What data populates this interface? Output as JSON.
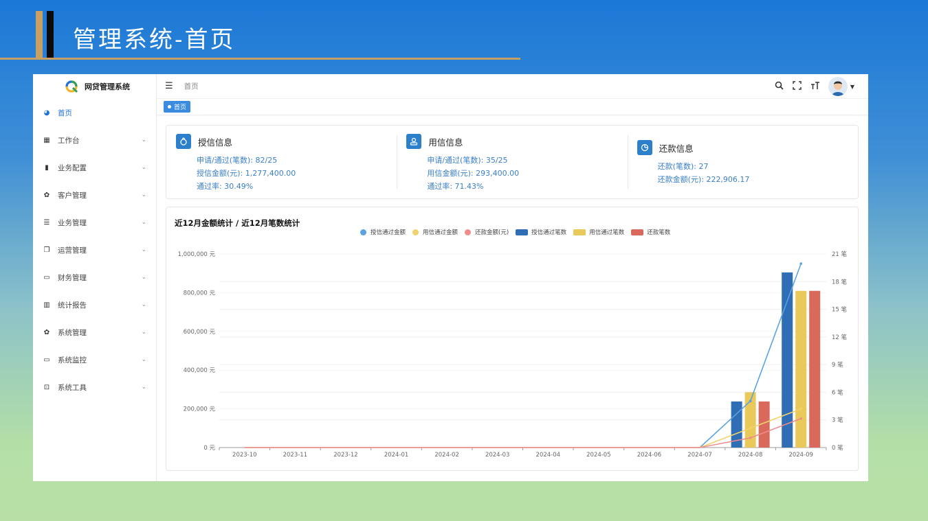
{
  "slide": {
    "title": "管理系统-首页"
  },
  "app": {
    "logo_text": "网贷管理系统",
    "breadcrumb": "首页",
    "tag": "首页"
  },
  "sidebar": {
    "items": [
      {
        "label": "首页",
        "icon": "dashboard-icon",
        "active": true,
        "expandable": false
      },
      {
        "label": "工作台",
        "icon": "grid-icon",
        "active": false,
        "expandable": true
      },
      {
        "label": "业务配置",
        "icon": "book-icon",
        "active": false,
        "expandable": true
      },
      {
        "label": "客户管理",
        "icon": "gear-icon",
        "active": false,
        "expandable": true
      },
      {
        "label": "业务管理",
        "icon": "sliders-icon",
        "active": false,
        "expandable": true
      },
      {
        "label": "运营管理",
        "icon": "copy-icon",
        "active": false,
        "expandable": true
      },
      {
        "label": "财务管理",
        "icon": "monitor-icon",
        "active": false,
        "expandable": true
      },
      {
        "label": "统计报告",
        "icon": "bar-chart-icon",
        "active": false,
        "expandable": true
      },
      {
        "label": "系统管理",
        "icon": "settings-icon",
        "active": false,
        "expandable": true
      },
      {
        "label": "系统监控",
        "icon": "monitor-icon",
        "active": false,
        "expandable": true
      },
      {
        "label": "系统工具",
        "icon": "toolbox-icon",
        "active": false,
        "expandable": true
      }
    ]
  },
  "info": [
    {
      "title": "授信信息",
      "icon": "money-bag-icon",
      "lines": [
        "申请/通过(笔数): 82/25",
        "授信金额(元): 1,277,400.00",
        "通过率: 30.49%"
      ]
    },
    {
      "title": "用信信息",
      "icon": "user-icon",
      "lines": [
        "申请/通过(笔数): 35/25",
        "用信金额(元): 293,400.00",
        "通过率: 71.43%"
      ]
    },
    {
      "title": "还款信息",
      "icon": "pie-icon",
      "lines": [
        "还款(笔数): 27",
        "还款金额(元): 222,906.17"
      ]
    }
  ],
  "colors": {
    "blue": "#2f6db5",
    "yellow": "#e8c95a",
    "red": "#d9695b",
    "line_blue": "#5ba3e0",
    "line_yellow": "#f2d36b",
    "line_red": "#f08c8c"
  },
  "chart_data": {
    "type": "bar+line",
    "title": "近12月金额统计 / 近12月笔数统计",
    "categories": [
      "2023-10",
      "2023-11",
      "2023-12",
      "2024-01",
      "2024-02",
      "2024-03",
      "2024-04",
      "2024-05",
      "2024-06",
      "2024-07",
      "2024-08",
      "2024-09"
    ],
    "y_left": {
      "ticks": [
        "0 元",
        "200,000 元",
        "400,000 元",
        "600,000 元",
        "800,000 元",
        "1,000,000 元"
      ],
      "range": [
        0,
        1000000
      ]
    },
    "y_right": {
      "ticks": [
        "0 笔",
        "3 笔",
        "6 笔",
        "9 笔",
        "12 笔",
        "15 笔",
        "18 笔",
        "21 笔"
      ],
      "range": [
        0,
        21
      ]
    },
    "legend_position": "top-center",
    "grid": true,
    "line_series": [
      {
        "name": "授信通过金额",
        "axis": "left",
        "color": "#5ba3e0",
        "values": [
          0,
          0,
          0,
          0,
          0,
          0,
          0,
          0,
          0,
          0,
          240000,
          950000
        ]
      },
      {
        "name": "用信通过金额",
        "axis": "left",
        "color": "#f2d36b",
        "values": [
          0,
          0,
          0,
          0,
          0,
          0,
          0,
          0,
          0,
          0,
          100000,
          200000
        ]
      },
      {
        "name": "还款金额(元)",
        "axis": "left",
        "color": "#f08c8c",
        "values": [
          0,
          0,
          0,
          0,
          0,
          0,
          0,
          0,
          0,
          0,
          50000,
          150000
        ]
      }
    ],
    "bar_series": [
      {
        "name": "授信通过笔数",
        "axis": "right",
        "color": "#2f6db5",
        "values": [
          0,
          0,
          0,
          0,
          0,
          0,
          0,
          0,
          0,
          0,
          5,
          19
        ]
      },
      {
        "name": "用信通过笔数",
        "axis": "right",
        "color": "#e8c95a",
        "values": [
          0,
          0,
          0,
          0,
          0,
          0,
          0,
          0,
          0,
          0,
          6,
          17
        ]
      },
      {
        "name": "还款笔数",
        "axis": "right",
        "color": "#d9695b",
        "values": [
          0,
          0,
          0,
          0,
          0,
          0,
          0,
          0,
          0,
          0,
          5,
          17
        ]
      }
    ]
  }
}
